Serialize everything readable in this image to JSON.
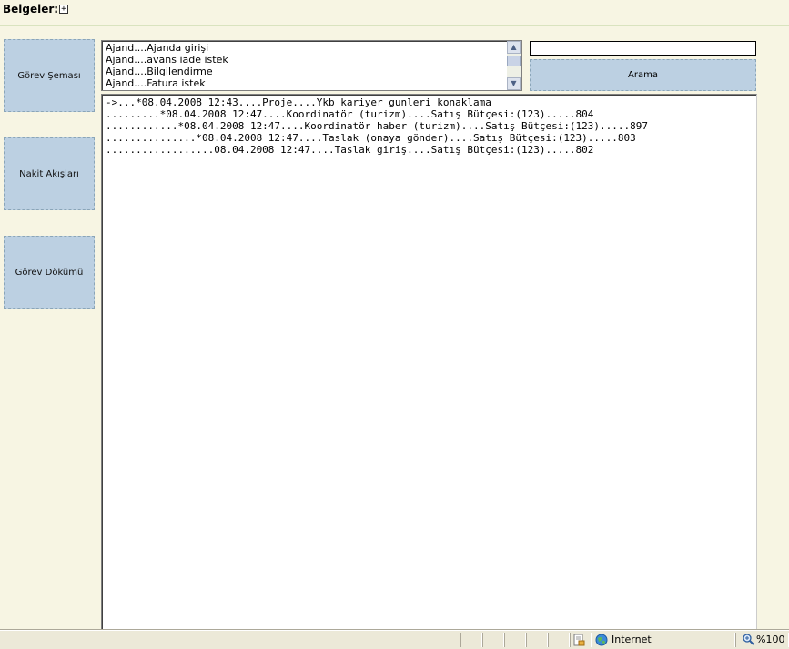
{
  "header": {
    "title": "Belgeler:",
    "expand_symbol": "+"
  },
  "left_buttons": [
    {
      "label": "Görev Şeması"
    },
    {
      "label": "Nakit Akışları"
    },
    {
      "label": "Görev Dökümü"
    }
  ],
  "listbox": {
    "items": [
      "Ajand....Ajanda girişi",
      "Ajand....avans iade istek",
      "Ajand....Bilgilendirme",
      "Ajand....Fatura istek"
    ]
  },
  "search": {
    "value": "",
    "button_label": "Arama"
  },
  "output": {
    "lines": [
      "->...*08.04.2008 12:43....Proje....Ykb kariyer gunleri konaklama",
      ".........*08.04.2008 12:47....Koordinatör (turizm)....Satış Bütçesi:(123).....804",
      "............*08.04.2008 12:47....Koordinatör haber (turizm)....Satış Bütçesi:(123).....897",
      "...............*08.04.2008 12:47....Taslak (onaya gönder)....Satış Bütçesi:(123).....803",
      "..................08.04.2008 12:47....Taslak giriş....Satış Bütçesi:(123).....802"
    ]
  },
  "statusbar": {
    "zone": "Internet",
    "zoom": "%100"
  },
  "icons": {
    "scroll_up": "scroll-up-arrow-icon",
    "scroll_down": "scroll-down-arrow-icon",
    "security": "security-report-icon",
    "zone": "globe-icon",
    "zoom": "zoom-magnifier-icon"
  }
}
